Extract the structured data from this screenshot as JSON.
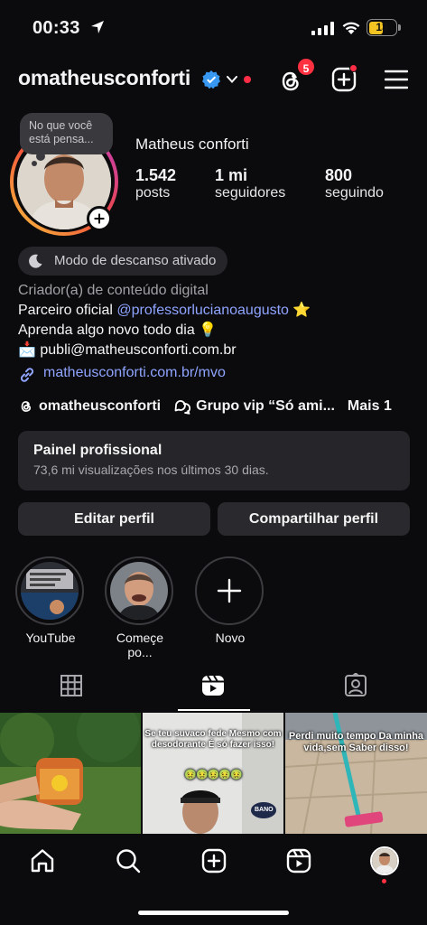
{
  "status_bar": {
    "time": "00:33",
    "battery": "13"
  },
  "header": {
    "username": "omatheusconforti",
    "threads_badge": "5"
  },
  "note": {
    "text": "No que você está pensa..."
  },
  "profile": {
    "full_name": "Matheus conforti",
    "stats": [
      {
        "value": "1.542",
        "label": "posts"
      },
      {
        "value": "1 mi",
        "label": "seguidores"
      },
      {
        "value": "800",
        "label": "seguindo"
      }
    ]
  },
  "rest_mode": {
    "label": "Modo de descanso ativado"
  },
  "bio": {
    "category": "Criador(a) de conteúdo digital",
    "line2_prefix": "Parceiro oficial ",
    "line2_mention": "@professorlucianoaugusto",
    "line2_suffix": " ⭐",
    "line3": "Aprenda algo novo todo dia 💡",
    "line4": "📩 publi@matheusconforti.com.br",
    "link": "matheusconforti.com.br/mvo"
  },
  "chips": {
    "threads": "omatheusconforti",
    "group": "Grupo vip “Só ami...",
    "more": "Mais 1"
  },
  "pro_panel": {
    "title": "Painel profissional",
    "subtitle": "73,6 mi visualizações nos últimos 30 dias."
  },
  "actions": {
    "edit": "Editar perfil",
    "share": "Compartilhar perfil"
  },
  "highlights": [
    {
      "label": "YouTube"
    },
    {
      "label": "Começe po..."
    },
    {
      "label": "Novo"
    }
  ],
  "grid": {
    "thumb2_caption": "Se teu suvaco fede Mesmo com desodorante É só fazer isso!",
    "thumb2_emojis": "🤢🤢🤢🤢🤢",
    "thumb2_sign": "BANO",
    "thumb3_caption": "Perdi muito tempo Da minha vida,sem Saber disso!"
  },
  "colors": {
    "accent_link": "#8fa4ff",
    "badge_red": "#ff3040",
    "background": "#0b0b0d"
  }
}
